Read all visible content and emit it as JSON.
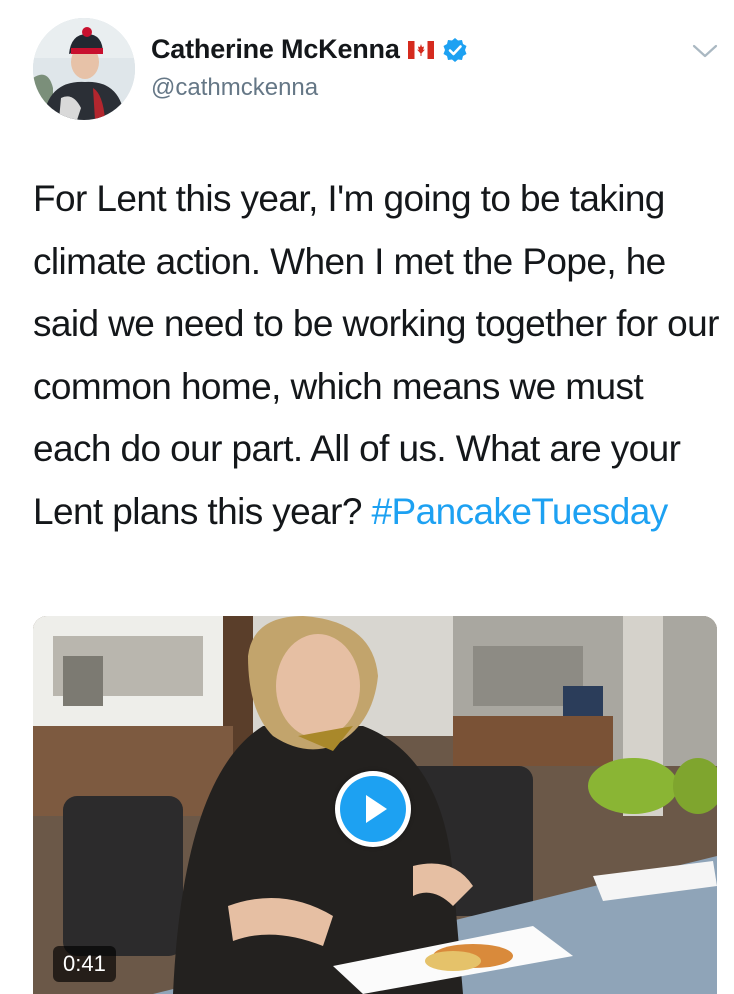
{
  "author": {
    "name": "Catherine McKenna",
    "handle": "@cathmckenna",
    "flag_icon": "canada-flag-icon",
    "verified_icon": "verified-badge-icon",
    "verified_color": "#1da1f2"
  },
  "menu": {
    "icon": "chevron-down-icon"
  },
  "tweet": {
    "text": "For Lent this year, I'm going to be taking climate action. When I met the Pope, he said we need to be working together for our common home, which means we must each do our part. All of us. What are your Lent plans this year? ",
    "hashtag": "#PancakeTuesday",
    "hashtag_color": "#1da1f2"
  },
  "video": {
    "duration": "0:41",
    "play_icon": "play-icon",
    "accent": "#1da1f2"
  }
}
